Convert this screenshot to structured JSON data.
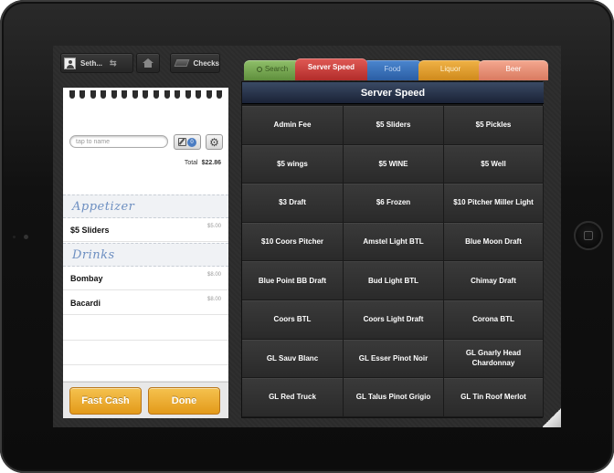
{
  "toolbar": {
    "user_name": "Seth...",
    "checks_label": "Checks"
  },
  "order": {
    "name_placeholder": "tap to name",
    "edit_count": "0",
    "total_label": "Total",
    "total_value": "$22.86",
    "sections": [
      {
        "title": "Appetizer",
        "items": [
          {
            "name": "$5 Sliders",
            "price": "$5.00"
          }
        ]
      },
      {
        "title": "Drinks",
        "items": [
          {
            "name": "Bombay",
            "price": "$8.00"
          },
          {
            "name": "Bacardi",
            "price": "$8.00"
          }
        ]
      }
    ],
    "fast_cash_label": "Fast Cash",
    "done_label": "Done"
  },
  "tabs": [
    {
      "label": "Search"
    },
    {
      "label": "Server Speed",
      "active": true
    },
    {
      "label": "Food"
    },
    {
      "label": "Liquor"
    },
    {
      "label": "Beer"
    }
  ],
  "menu": {
    "title": "Server Speed",
    "items": [
      "Admin Fee",
      "$5 Sliders",
      "$5 Pickles",
      "$5 wings",
      "$5 WINE",
      "$5 Well",
      "$3 Draft",
      "$6 Frozen",
      "$10 Pitcher Miller Light",
      "$10 Coors Pitcher",
      "Amstel Light BTL",
      "Blue Moon Draft",
      "Blue Point BB Draft",
      "Bud Light BTL",
      "Chimay Draft",
      "Coors BTL",
      "Coors Light Draft",
      "Corona BTL",
      "GL Sauv Blanc",
      "GL Esser Pinot Noir",
      "GL Gnarly Head Chardonnay",
      "GL Red Truck",
      "GL Talus Pinot Grigio",
      "GL Tin Roof Merlot"
    ]
  },
  "colors": {
    "accent_orange": "#e39a1a",
    "tab_search": "#5f8f3c",
    "tab_speed": "#b22c2a",
    "tab_food": "#2b5ea4",
    "tab_liquor": "#cf8a1c",
    "tab_beer": "#d97a60",
    "section_header_text": "#6d8fc1"
  },
  "icons": [
    "avatar-icon",
    "transfer-icon",
    "home-icon",
    "checks-icon",
    "edit-icon",
    "gear-icon",
    "search-icon"
  ]
}
